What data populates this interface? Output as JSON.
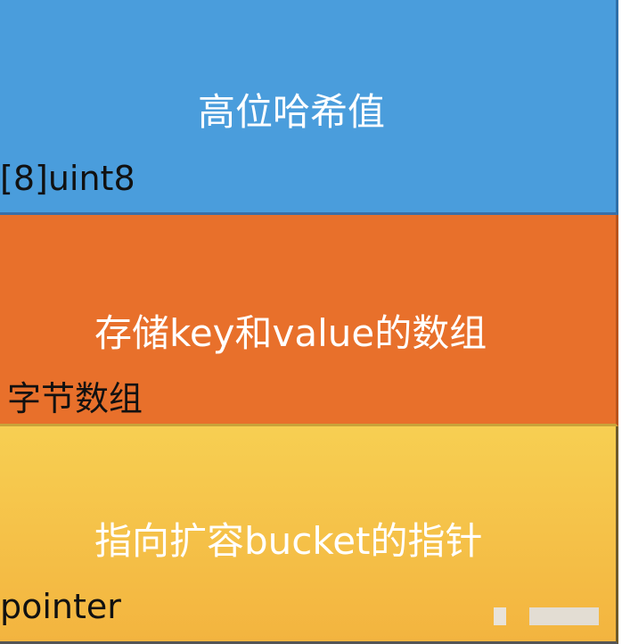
{
  "blocks": [
    {
      "title": "高位哈希值",
      "type_label": "[8]uint8",
      "color": "#4a9ddc"
    },
    {
      "title": "存储key和value的数组",
      "type_label": "字节数组",
      "color": "#e8702b"
    },
    {
      "title": "指向扩容bucket的指针",
      "type_label": "pointer",
      "color": "#f5c04a"
    }
  ]
}
